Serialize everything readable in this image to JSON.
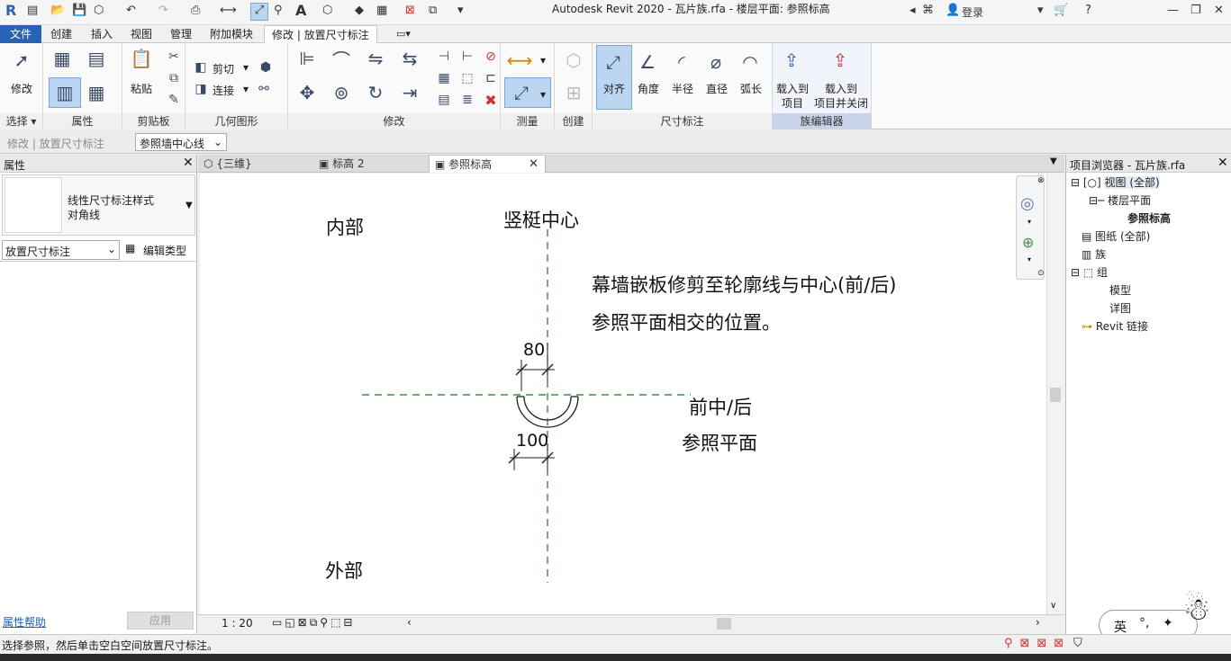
{
  "app": {
    "title": "Autodesk Revit 2020 - 瓦片族.rfa - 楼层平面: 参照标高",
    "login_label": "登录"
  },
  "menu": {
    "file": "文件",
    "tabs": [
      "创建",
      "插入",
      "视图",
      "管理",
      "附加模块"
    ],
    "active": "修改 | 放置尺寸标注"
  },
  "ribbon": {
    "select": {
      "modify": "修改",
      "label": "选择"
    },
    "properties_label": "属性",
    "clipboard": {
      "paste": "粘贴",
      "label": "剪贴板"
    },
    "geometry": {
      "cut": "剪切",
      "join": "连接",
      "label": "几何图形"
    },
    "modify_label": "修改",
    "measure_label": "测量",
    "create_label": "创建",
    "dimension": {
      "buttons": [
        "对齐",
        "角度",
        "半径",
        "直径",
        "弧长"
      ],
      "label": "尺寸标注"
    },
    "family_editor": {
      "load": [
        "载入到",
        "项目"
      ],
      "load_close": [
        "载入到",
        "项目并关闭"
      ],
      "label": "族编辑器"
    }
  },
  "options_bar": {
    "context": "修改 | 放置尺寸标注",
    "dropdown": "参照墙中心线"
  },
  "properties": {
    "title": "属性",
    "type_line1": "线性尺寸标注样式",
    "type_line2": "对角线",
    "filter": "放置尺寸标注",
    "edit_type": "编辑类型",
    "help": "属性帮助",
    "apply": "应用"
  },
  "view_tabs": [
    {
      "label": "{三维}"
    },
    {
      "label": "标高 2"
    },
    {
      "label": "参照标高"
    }
  ],
  "canvas": {
    "interior": "内部",
    "exterior": "外部",
    "mullion_center": "竖梃中心",
    "note_line1": "幕墙嵌板修剪至轮廓线与中心(前/后)",
    "note_line2": "参照平面相交的位置。",
    "dim_top": "80",
    "dim_bottom": "100",
    "front_back_line1": "前中/后",
    "front_back_line2": "参照平面"
  },
  "view_control": {
    "scale": "1 : 20"
  },
  "browser": {
    "title": "项目浏览器 - 瓦片族.rfa",
    "items": [
      {
        "label": "视图 (全部)"
      },
      {
        "label": "楼层平面"
      },
      {
        "label": "参照标高"
      },
      {
        "label": "图纸 (全部)"
      },
      {
        "label": "族"
      },
      {
        "label": "组"
      },
      {
        "label": "模型"
      },
      {
        "label": "详图"
      },
      {
        "label": "Revit 链接"
      }
    ]
  },
  "status": {
    "message": "选择参照，然后单击空白空间放置尺寸标注。"
  },
  "ime": {
    "label": "英"
  }
}
